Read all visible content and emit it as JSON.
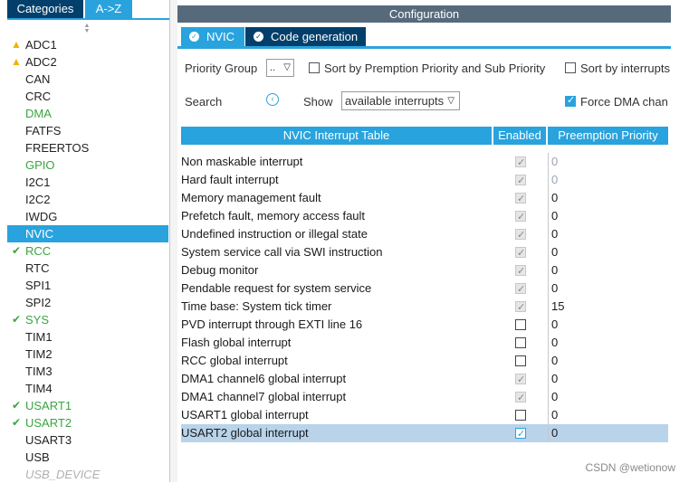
{
  "left_panel": {
    "tabs": {
      "categories": "Categories",
      "az": "A->Z"
    },
    "items": [
      {
        "label": "ADC1",
        "status": "warning"
      },
      {
        "label": "ADC2",
        "status": "warning"
      },
      {
        "label": "CAN",
        "status": "none"
      },
      {
        "label": "CRC",
        "status": "none"
      },
      {
        "label": "DMA",
        "status": "green"
      },
      {
        "label": "FATFS",
        "status": "none"
      },
      {
        "label": "FREERTOS",
        "status": "none"
      },
      {
        "label": "GPIO",
        "status": "green"
      },
      {
        "label": "I2C1",
        "status": "none"
      },
      {
        "label": "I2C2",
        "status": "none"
      },
      {
        "label": "IWDG",
        "status": "none"
      },
      {
        "label": "NVIC",
        "status": "selected"
      },
      {
        "label": "RCC",
        "status": "checked"
      },
      {
        "label": "RTC",
        "status": "none"
      },
      {
        "label": "SPI1",
        "status": "none"
      },
      {
        "label": "SPI2",
        "status": "none"
      },
      {
        "label": "SYS",
        "status": "checked"
      },
      {
        "label": "TIM1",
        "status": "none"
      },
      {
        "label": "TIM2",
        "status": "none"
      },
      {
        "label": "TIM3",
        "status": "none"
      },
      {
        "label": "TIM4",
        "status": "none"
      },
      {
        "label": "USART1",
        "status": "checked"
      },
      {
        "label": "USART2",
        "status": "checked"
      },
      {
        "label": "USART3",
        "status": "none"
      },
      {
        "label": "USB",
        "status": "none"
      },
      {
        "label": "USB_DEVICE",
        "status": "disabled"
      }
    ]
  },
  "config": {
    "title": "Configuration",
    "tabs": {
      "nvic": "NVIC",
      "code": "Code generation"
    },
    "priority_group": {
      "label": "Priority Group",
      "value": ".."
    },
    "sort_premption": "Sort by Premption Priority and Sub Priority",
    "sort_interrupts": "Sort by interrupts",
    "search_label": "Search",
    "show_label": "Show",
    "show_value": "available interrupts",
    "force_dma": "Force DMA chan"
  },
  "table": {
    "headers": {
      "name": "NVIC Interrupt Table",
      "enabled": "Enabled",
      "priority": "Preemption Priority"
    },
    "rows": [
      {
        "name": "Non maskable interrupt",
        "enabled": true,
        "locked": true,
        "priority": "0",
        "pri_grey": true
      },
      {
        "name": "Hard fault interrupt",
        "enabled": true,
        "locked": true,
        "priority": "0",
        "pri_grey": true
      },
      {
        "name": "Memory management fault",
        "enabled": true,
        "locked": true,
        "priority": "0",
        "pri_grey": false
      },
      {
        "name": "Prefetch fault, memory access fault",
        "enabled": true,
        "locked": true,
        "priority": "0",
        "pri_grey": false
      },
      {
        "name": "Undefined instruction or illegal state",
        "enabled": true,
        "locked": true,
        "priority": "0",
        "pri_grey": false
      },
      {
        "name": "System service call via SWI instruction",
        "enabled": true,
        "locked": true,
        "priority": "0",
        "pri_grey": false
      },
      {
        "name": "Debug monitor",
        "enabled": true,
        "locked": true,
        "priority": "0",
        "pri_grey": false
      },
      {
        "name": "Pendable request for system service",
        "enabled": true,
        "locked": true,
        "priority": "0",
        "pri_grey": false
      },
      {
        "name": "Time base: System tick timer",
        "enabled": true,
        "locked": true,
        "priority": "15",
        "pri_grey": false
      },
      {
        "name": "PVD interrupt through EXTI line 16",
        "enabled": false,
        "locked": false,
        "priority": "0",
        "pri_grey": false
      },
      {
        "name": "Flash global interrupt",
        "enabled": false,
        "locked": false,
        "priority": "0",
        "pri_grey": false
      },
      {
        "name": "RCC global interrupt",
        "enabled": false,
        "locked": false,
        "priority": "0",
        "pri_grey": false
      },
      {
        "name": "DMA1 channel6 global interrupt",
        "enabled": true,
        "locked": true,
        "priority": "0",
        "pri_grey": false
      },
      {
        "name": "DMA1 channel7 global interrupt",
        "enabled": true,
        "locked": true,
        "priority": "0",
        "pri_grey": false
      },
      {
        "name": "USART1 global interrupt",
        "enabled": false,
        "locked": false,
        "priority": "0",
        "pri_grey": false
      },
      {
        "name": "USART2 global interrupt",
        "enabled": true,
        "locked": false,
        "priority": "0",
        "pri_grey": false,
        "selected": true
      }
    ]
  },
  "watermark": "CSDN @wetionow",
  "colors": {
    "accent": "#29a3dd",
    "dark_tab": "#033f6b",
    "title_bar": "#566a7b",
    "selected_row": "#b8d3ea"
  }
}
